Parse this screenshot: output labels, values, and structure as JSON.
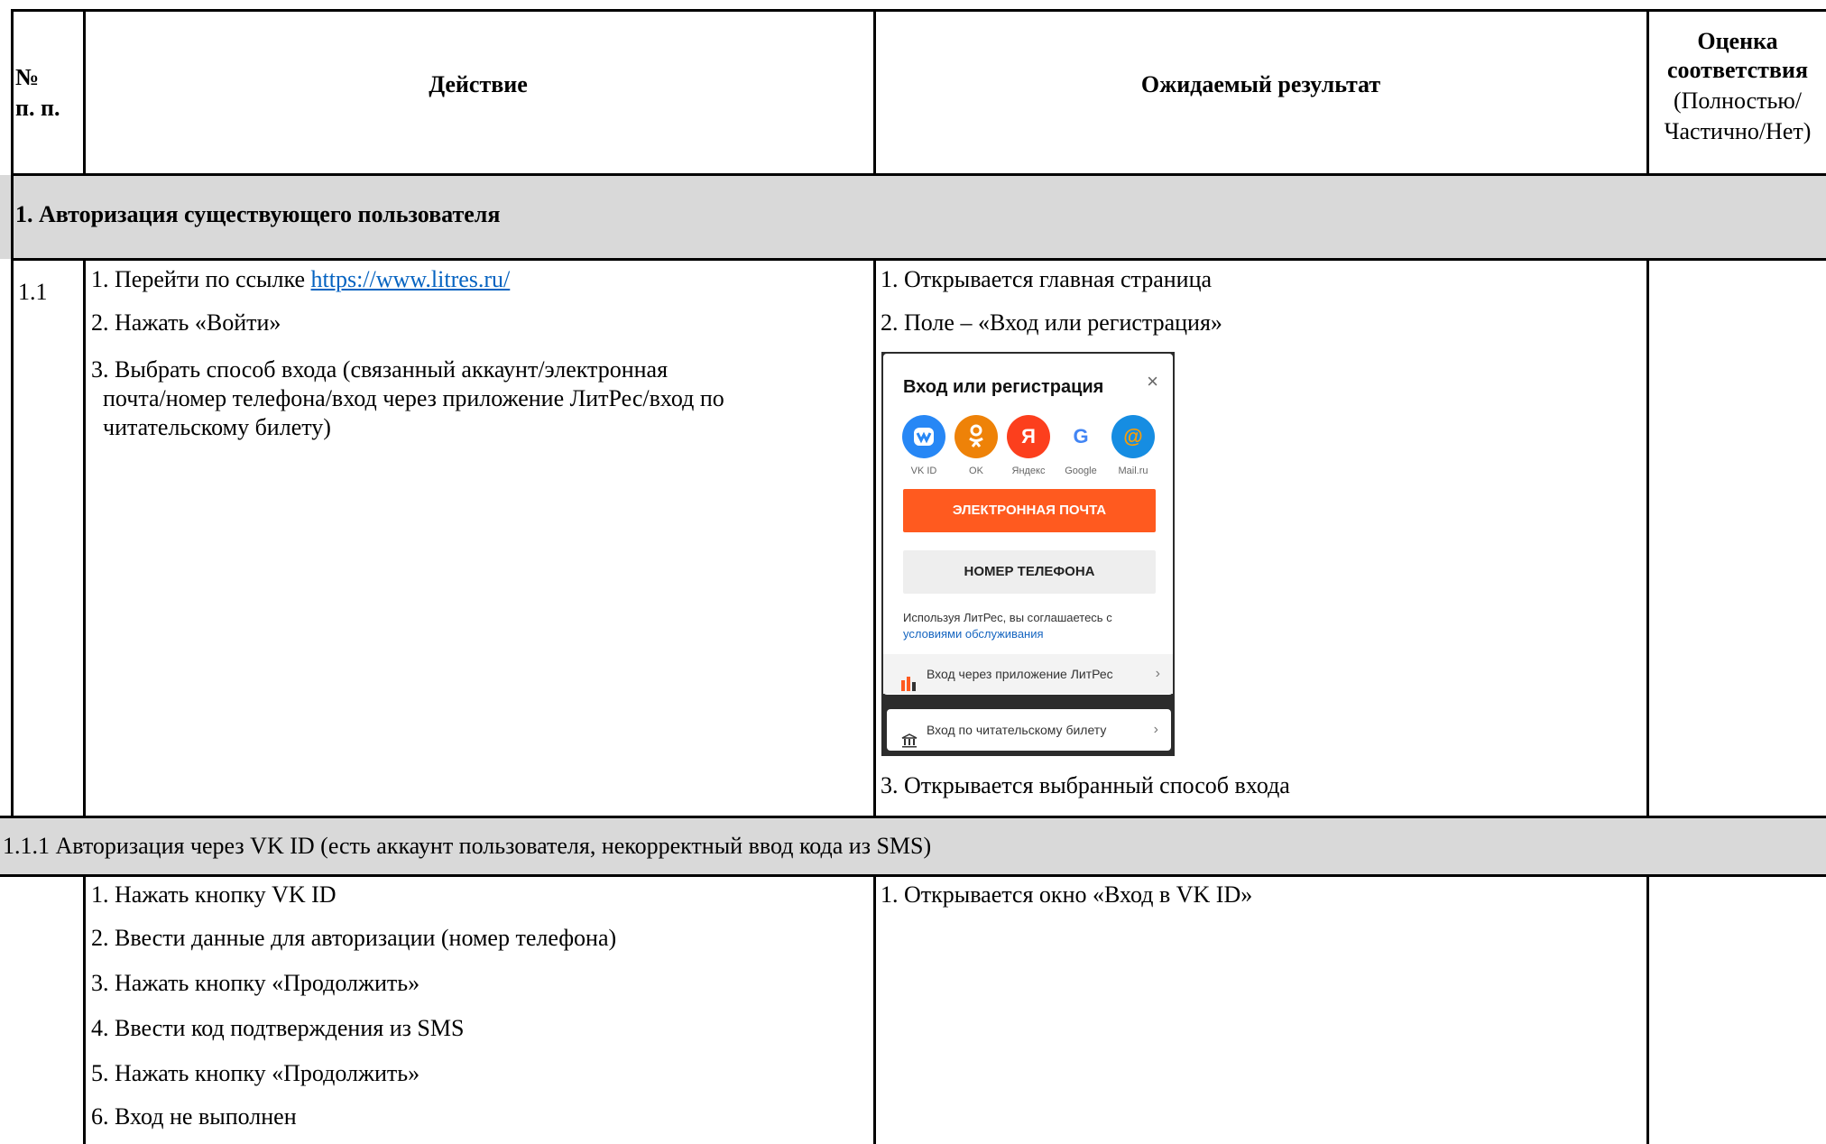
{
  "header": {
    "num_label_line1": "№",
    "num_label_line2": "п. п.",
    "action_label": "Действие",
    "expected_label": "Ожидаемый результат",
    "eval_label_line1": "Оценка",
    "eval_label_line2": "соответствия",
    "eval_label_line3": "(Полностью/",
    "eval_label_line4": "Частично/Нет)"
  },
  "section1": {
    "title": "1. Авторизация существующего пользователя"
  },
  "row_1_1": {
    "num": "1.1",
    "action_1_prefix": "1. Перейти по ссылке ",
    "action_1_link": "https://www.litres.ru/",
    "action_2": "2. Нажать «Войти»",
    "action_3_line1": "3. Выбрать способ входа (связанный аккаунт/электронная",
    "action_3_line2": "почта/номер телефона/вход через приложение ЛитРес/вход по",
    "action_3_line3": "читательскому билету)",
    "expected_1": "1. Открывается главная страница",
    "expected_2": "2. Поле – «Вход или регистрация»",
    "expected_3": "3. Открывается выбранный способ входа"
  },
  "login_screenshot": {
    "title": "Вход или регистрация",
    "close_glyph": "×",
    "services": [
      {
        "label": "VK ID",
        "glyph": "vk",
        "color": "#2787f5"
      },
      {
        "label": "OK",
        "glyph": "ok",
        "color": "#ee8208"
      },
      {
        "label": "Яндекс",
        "glyph": "Я",
        "color": "#fc3f1d"
      },
      {
        "label": "Google",
        "glyph": "G",
        "color": "#ffffff"
      },
      {
        "label": "Mail.ru",
        "glyph": "@",
        "color": "#168de2"
      }
    ],
    "email_button": "ЭЛЕКТРОННАЯ ПОЧТА",
    "phone_button": "НОМЕР ТЕЛЕФОНА",
    "terms_line1": "Используя ЛитРес, вы соглашаетесь с",
    "terms_link": "условиями обслуживания",
    "app_login": "Вход через приложение ЛитРес",
    "library_login": "Вход по читательскому билету",
    "chevron": "›"
  },
  "section_1_1_1": {
    "title": "1.1.1 Авторизация через VK ID (есть аккаунт пользователя, некорректный ввод кода из SMS)"
  },
  "row_1_1_1": {
    "num": "",
    "actions": [
      "1. Нажать кнопку VK ID",
      "2. Ввести данные для авторизации (номер телефона)",
      "3. Нажать кнопку «Продолжить»",
      "4. Ввести код подтверждения из SMS",
      "5. Нажать кнопку «Продолжить»",
      "6. Вход не выполнен"
    ],
    "expected_1": "1. Открывается окно «Вход в VK ID»"
  }
}
